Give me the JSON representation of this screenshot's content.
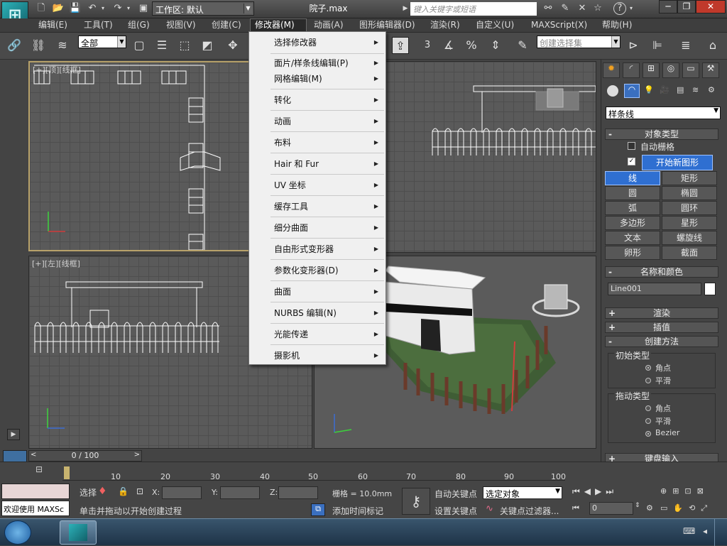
{
  "titlebar": {
    "workspace": "工作区: 默认",
    "file": "院子.max",
    "search_placeholder": "键入关键字或短语"
  },
  "menubar": [
    "编辑(E)",
    "工具(T)",
    "组(G)",
    "视图(V)",
    "创建(C)",
    "修改器(M)",
    "动画(A)",
    "图形编辑器(D)",
    "渲染(R)",
    "自定义(U)",
    "MAXScript(X)",
    "帮助(H)"
  ],
  "toolbar": {
    "selection_filter": "全部",
    "named_selection": "创建选择集",
    "snap_label": "3",
    "percent_label": "%"
  },
  "modifier_menu": [
    {
      "label": "选择修改器"
    },
    {
      "label": "面片/样条线编辑(P)"
    },
    {
      "label": "网格编辑(M)"
    },
    {
      "label": "转化"
    },
    {
      "label": "动画"
    },
    {
      "label": "布料"
    },
    {
      "label": "Hair 和 Fur"
    },
    {
      "label": "UV 坐标"
    },
    {
      "label": "缓存工具"
    },
    {
      "label": "细分曲面"
    },
    {
      "label": "自由形式变形器"
    },
    {
      "label": "参数化变形器(D)"
    },
    {
      "label": "曲面"
    },
    {
      "label": "NURBS 编辑(N)"
    },
    {
      "label": "光能传递"
    },
    {
      "label": "摄影机"
    }
  ],
  "viewports": {
    "top_label": "[+][顶][线框]",
    "left_label": "[+][左][线框]"
  },
  "command_panel": {
    "category": "样条线",
    "object_type_title": "对象类型",
    "autogrid": "自动栅格",
    "start_new_shape": "开始新图形",
    "objects": [
      "线",
      "矩形",
      "圆",
      "椭圆",
      "弧",
      "圆环",
      "多边形",
      "星形",
      "文本",
      "螺旋线",
      "卵形",
      "截面"
    ],
    "name_color_title": "名称和颜色",
    "object_name": "Line001",
    "render_title": "渲染",
    "interp_title": "插值",
    "creation_method_title": "创建方法",
    "initial_type_title": "初始类型",
    "initial_types": [
      "角点",
      "平滑"
    ],
    "drag_type_title": "拖动类型",
    "drag_types": [
      "角点",
      "平滑",
      "Bezier"
    ],
    "keyboard_title": "键盘输入"
  },
  "timeline": {
    "frame_display": "0 / 100",
    "ticks": [
      "10",
      "20",
      "30",
      "40",
      "50",
      "60",
      "70",
      "80",
      "90",
      "100"
    ]
  },
  "status": {
    "welcome": "欢迎使用 MAXSc",
    "selection_label": "选择",
    "x_label": "X:",
    "y_label": "Y:",
    "z_label": "Z:",
    "grid": "栅格 = 10.0mm",
    "prompt": "单击并拖动以开始创建过程",
    "add_time_tag": "添加时间标记",
    "auto_key": "自动关键点",
    "set_key": "设置关键点",
    "selected_object": "选定对象",
    "key_filter": "关键点过滤器...",
    "frame_value": "0"
  },
  "colors": {
    "accent_blue": "#2f6fd1",
    "viewport_bg": "#5a5a5a",
    "active_border": "#b8a26a"
  }
}
